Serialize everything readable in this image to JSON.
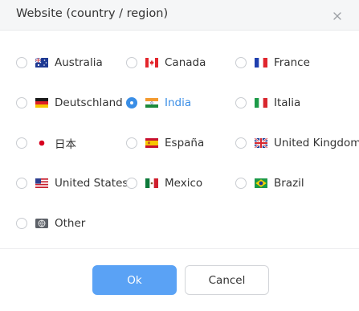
{
  "dialog": {
    "title": "Website (country / region)"
  },
  "options": [
    {
      "label": "Australia",
      "icon": "flag-australia-icon",
      "selected": false
    },
    {
      "label": "Canada",
      "icon": "flag-canada-icon",
      "selected": false
    },
    {
      "label": "France",
      "icon": "flag-france-icon",
      "selected": false
    },
    {
      "label": "Deutschland",
      "icon": "flag-germany-icon",
      "selected": false
    },
    {
      "label": "India",
      "icon": "flag-india-icon",
      "selected": true
    },
    {
      "label": "Italia",
      "icon": "flag-italy-icon",
      "selected": false
    },
    {
      "label": "日本",
      "icon": "flag-japan-icon",
      "selected": false
    },
    {
      "label": "España",
      "icon": "flag-spain-icon",
      "selected": false
    },
    {
      "label": "United Kingdom",
      "icon": "flag-uk-icon",
      "selected": false
    },
    {
      "label": "United States",
      "icon": "flag-usa-icon",
      "selected": false
    },
    {
      "label": "Mexico",
      "icon": "flag-mexico-icon",
      "selected": false
    },
    {
      "label": "Brazil",
      "icon": "flag-brazil-icon",
      "selected": false
    },
    {
      "label": "Other",
      "icon": "globe-icon",
      "selected": false
    }
  ],
  "buttons": {
    "ok": "Ok",
    "cancel": "Cancel"
  },
  "colors": {
    "accent": "#3a8ee6",
    "ok_button": "#5aa2f5",
    "header_bg": "#f5f6f7"
  }
}
